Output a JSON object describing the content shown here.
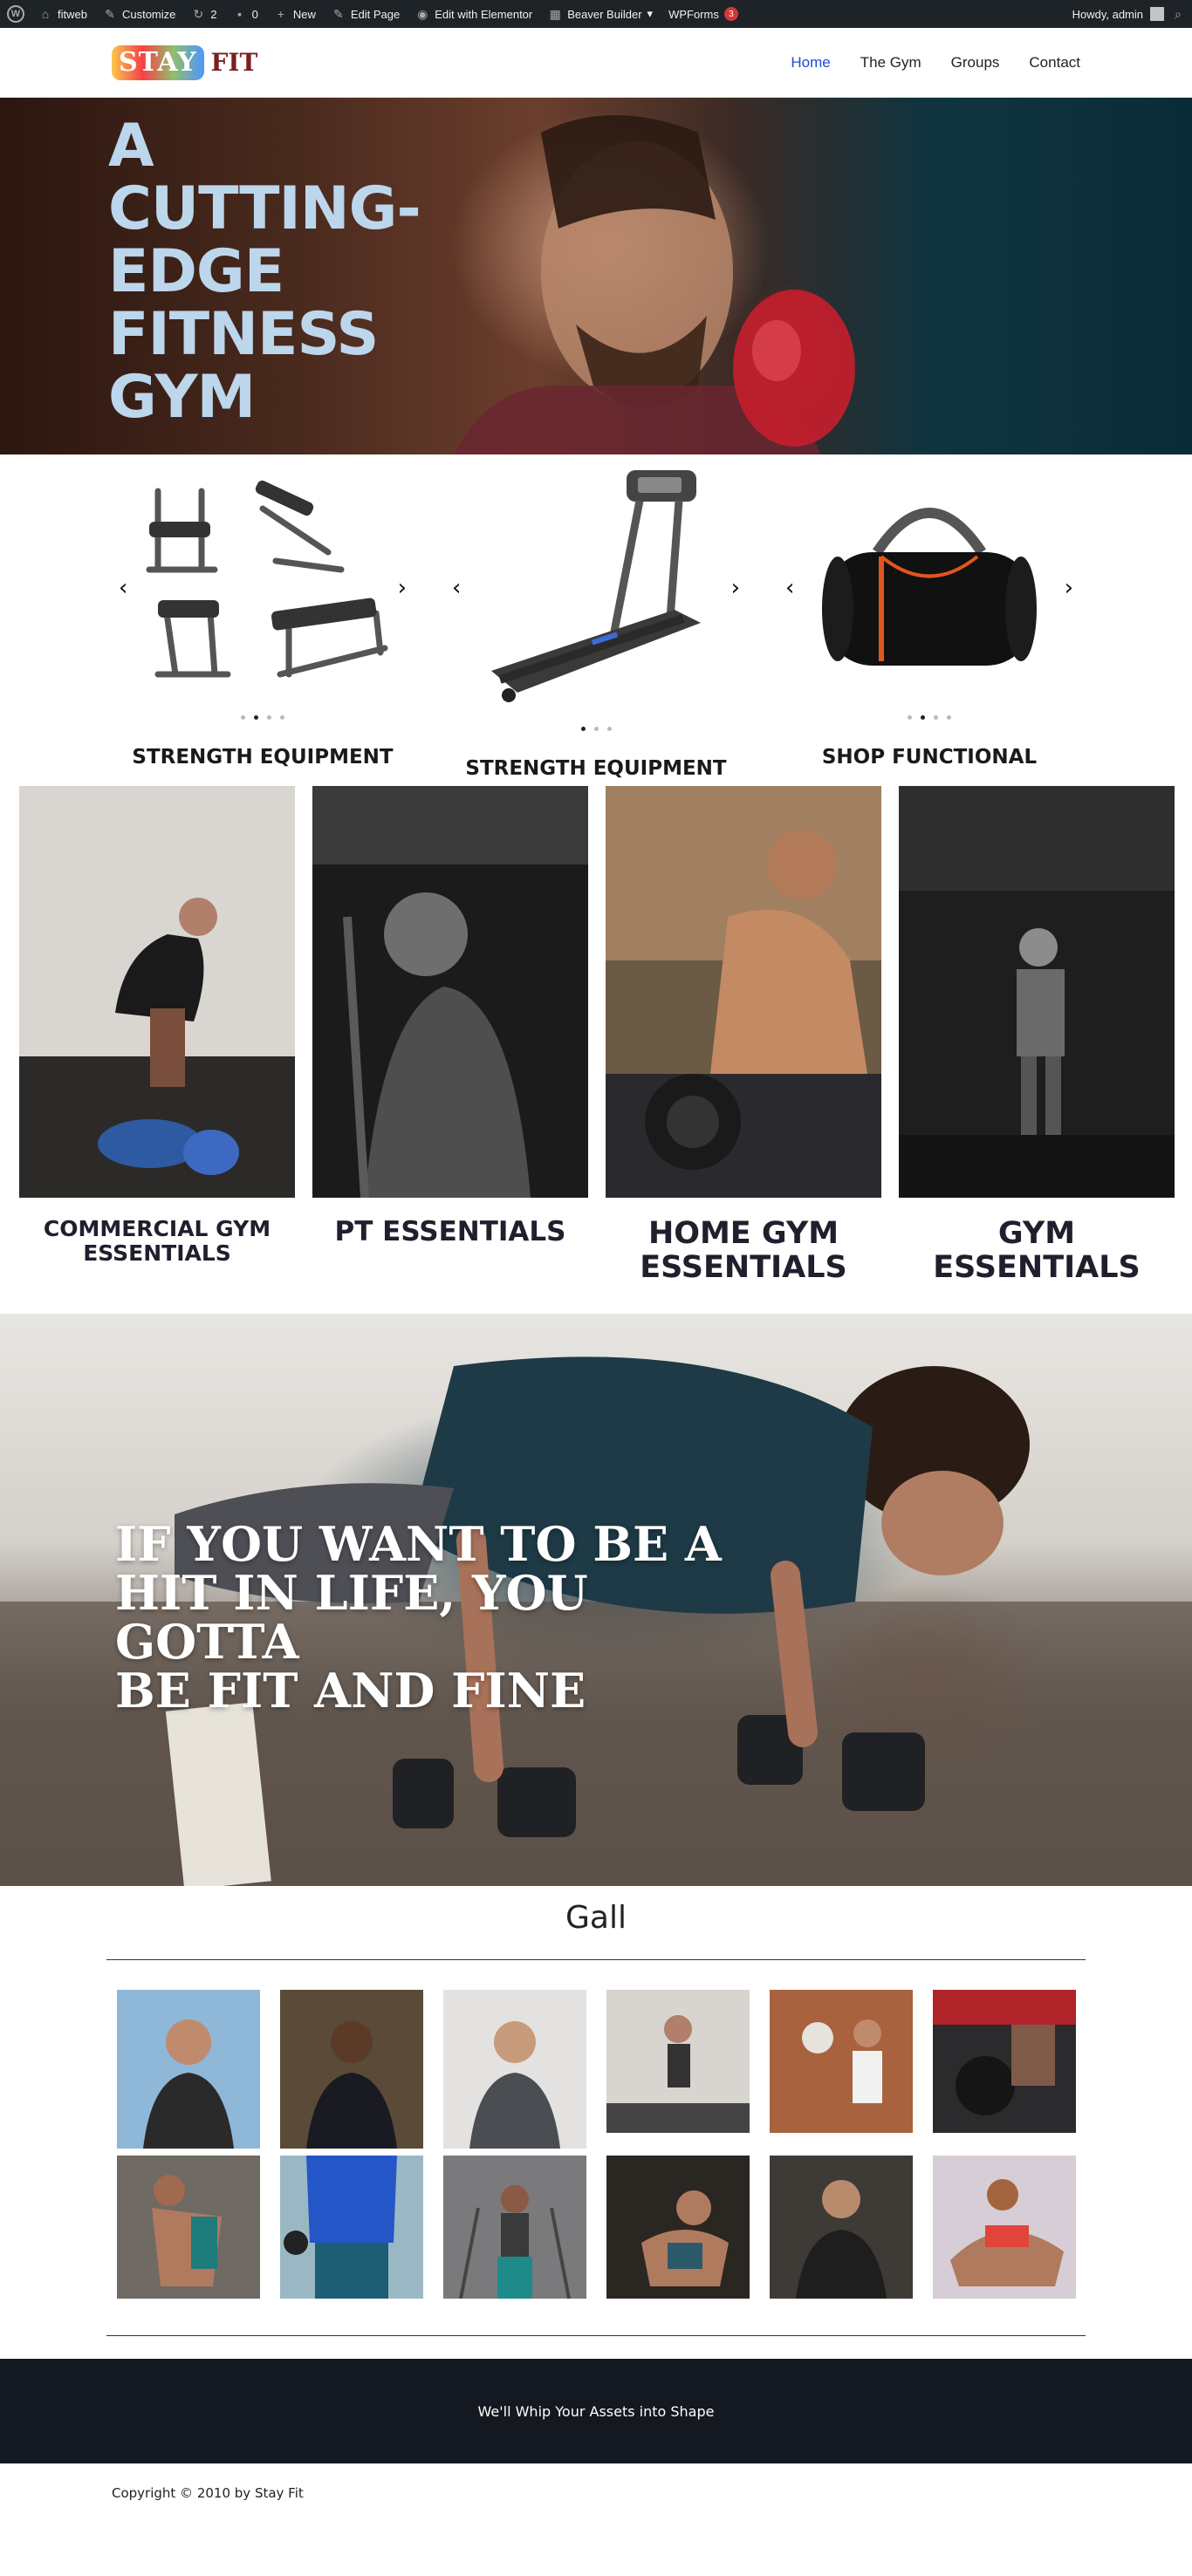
{
  "adminbar": {
    "site": "fitweb",
    "customize": "Customize",
    "revisions_count": "2",
    "comments_count": "0",
    "new": "New",
    "edit_page": "Edit Page",
    "elementor": "Edit with Elementor",
    "beaver": "Beaver Builder",
    "wpforms": "WPForms",
    "wpforms_badge": "3",
    "howdy": "Howdy, admin"
  },
  "header": {
    "logo_badge": "STAY",
    "logo_text": "FIT",
    "nav": [
      {
        "label": "Home",
        "active": true
      },
      {
        "label": "The Gym",
        "active": false
      },
      {
        "label": "Groups",
        "active": false
      },
      {
        "label": "Contact",
        "active": false
      }
    ]
  },
  "hero": {
    "title_lines": [
      "A",
      "CUTTING-",
      "EDGE",
      "FITNESS",
      "GYM"
    ]
  },
  "products": [
    {
      "label": "STRENGTH EQUIPMENT",
      "image": "weight-benches",
      "active_dot": 1,
      "dot_count": 4
    },
    {
      "label": "STRENGTH EQUIPMENT",
      "image": "treadmill",
      "active_dot": 0,
      "dot_count": 3
    },
    {
      "label": "SHOP FUNCTIONAL",
      "image": "gym-bag",
      "active_dot": 1,
      "dot_count": 4
    }
  ],
  "categories": [
    {
      "label": "COMMERCIAL GYM ESSENTIALS"
    },
    {
      "label": "PT ESSENTIALS"
    },
    {
      "label": "HOME GYM ESSENTIALS"
    },
    {
      "label": "GYM ESSENTIALS"
    }
  ],
  "quote": {
    "lines": [
      "IF YOU WANT TO BE A",
      "HIT IN LIFE, YOU GOTTA",
      "BE FIT AND FINE"
    ]
  },
  "gallery": {
    "title": "Gall"
  },
  "footer": {
    "tagline": "We'll Whip Your Assets into Shape",
    "copyright": "Copyright © 2010 by Stay Fit"
  },
  "colors": {
    "admin_bar": "#1d2327",
    "nav_active": "#1e4bd8",
    "hero_text": "#bcd6ec",
    "footer_band": "#141820"
  }
}
